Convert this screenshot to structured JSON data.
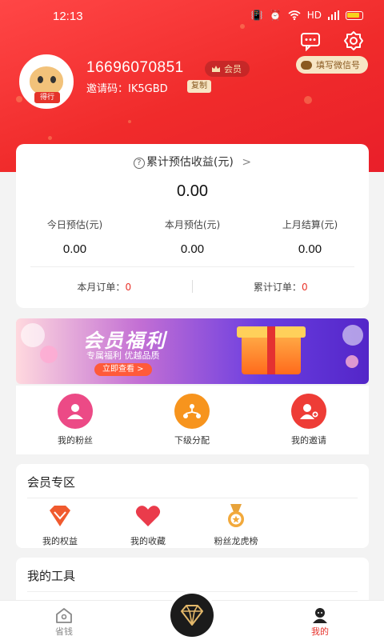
{
  "status_bar": {
    "time": "12:13",
    "network": "HD"
  },
  "profile": {
    "avatar_tag": "得行",
    "phone": "16696070851",
    "member_label": "会员",
    "invite_label": "邀请码：IK5GBD",
    "copy_label": "复制",
    "wechat_button": "填写微信号"
  },
  "earnings": {
    "title": "累计预估收益(元)",
    "arrow": ">",
    "total": "0.00",
    "stats": [
      {
        "label": "今日预估(元)",
        "value": "0.00"
      },
      {
        "label": "本月预估(元)",
        "value": "0.00"
      },
      {
        "label": "上月结算(元)",
        "value": "0.00"
      }
    ],
    "monthly_orders_label": "本月订单：",
    "monthly_orders_value": "0",
    "total_orders_label": "累计订单：",
    "total_orders_value": "0"
  },
  "banner": {
    "title": "会员福利",
    "subtitle": "专属福利 优越品质",
    "cta": "立即查看 >"
  },
  "quick_actions": [
    {
      "label": "我的粉丝",
      "icon": "fans-icon",
      "color": "#ec4a86"
    },
    {
      "label": "下级分配",
      "icon": "share-icon",
      "color": "#f7941d"
    },
    {
      "label": "我的邀请",
      "icon": "invite-icon",
      "color": "#ee3c36"
    }
  ],
  "member_zone": {
    "title": "会员专区",
    "items": [
      {
        "label": "我的权益",
        "icon": "diamond-icon"
      },
      {
        "label": "我的收藏",
        "icon": "heart-icon"
      },
      {
        "label": "粉丝龙虎榜",
        "icon": "medal-icon"
      }
    ]
  },
  "tools": {
    "title": "我的工具"
  },
  "tabbar": {
    "items": [
      {
        "label": "省钱",
        "icon": "home-icon"
      },
      {
        "label": "我的",
        "icon": "user-icon"
      }
    ],
    "active_color": "#e6312a"
  }
}
